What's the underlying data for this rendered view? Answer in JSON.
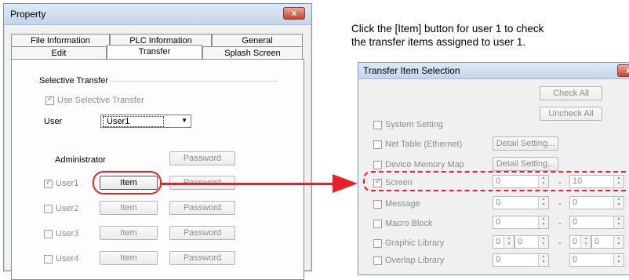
{
  "property_dialog": {
    "title": "Property",
    "close_label": "x",
    "tabs_row1": [
      "File Information",
      "PLC Information",
      "General"
    ],
    "tabs_row2": [
      "Edit",
      "Transfer",
      "Splash Screen"
    ],
    "active_tab": "Transfer",
    "group_title": "Selective Transfer",
    "use_selective_label": "Use Selective Transfer",
    "user_label": "User",
    "user_value": "User1",
    "administrator_label": "Administrator",
    "password_label": "Password",
    "item_label": "Item",
    "users": [
      "User1",
      "User2",
      "User3",
      "User4"
    ]
  },
  "annotation": {
    "line1": "Click the [Item] button for user 1 to check",
    "line2": "the transfer items assigned to user 1."
  },
  "accent_color": "#e8202a",
  "transfer_dialog": {
    "title": "Transfer Item Selection",
    "close_label": "x",
    "check_all": "Check All",
    "uncheck_all": "Uncheck All",
    "detail_setting": "Detail Setting...",
    "rows": [
      {
        "label": "System Setting",
        "checked": false
      },
      {
        "label": "Net Table (Ethernet)",
        "checked": false
      },
      {
        "label": "Device Memory Map",
        "checked": false
      },
      {
        "label": "Screen",
        "checked": true,
        "from": "0",
        "to": "10"
      },
      {
        "label": "Message",
        "checked": false,
        "from": "0",
        "to": "0"
      },
      {
        "label": "Macro Block",
        "checked": false,
        "from": "0",
        "to": "0"
      },
      {
        "label": "Graphic Library",
        "checked": false,
        "from": "0",
        "from2": "0",
        "to": "0",
        "to2": "0"
      },
      {
        "label": "Overlap Library",
        "checked": false,
        "from": "0",
        "to": "0"
      }
    ],
    "range_sep": "-"
  }
}
